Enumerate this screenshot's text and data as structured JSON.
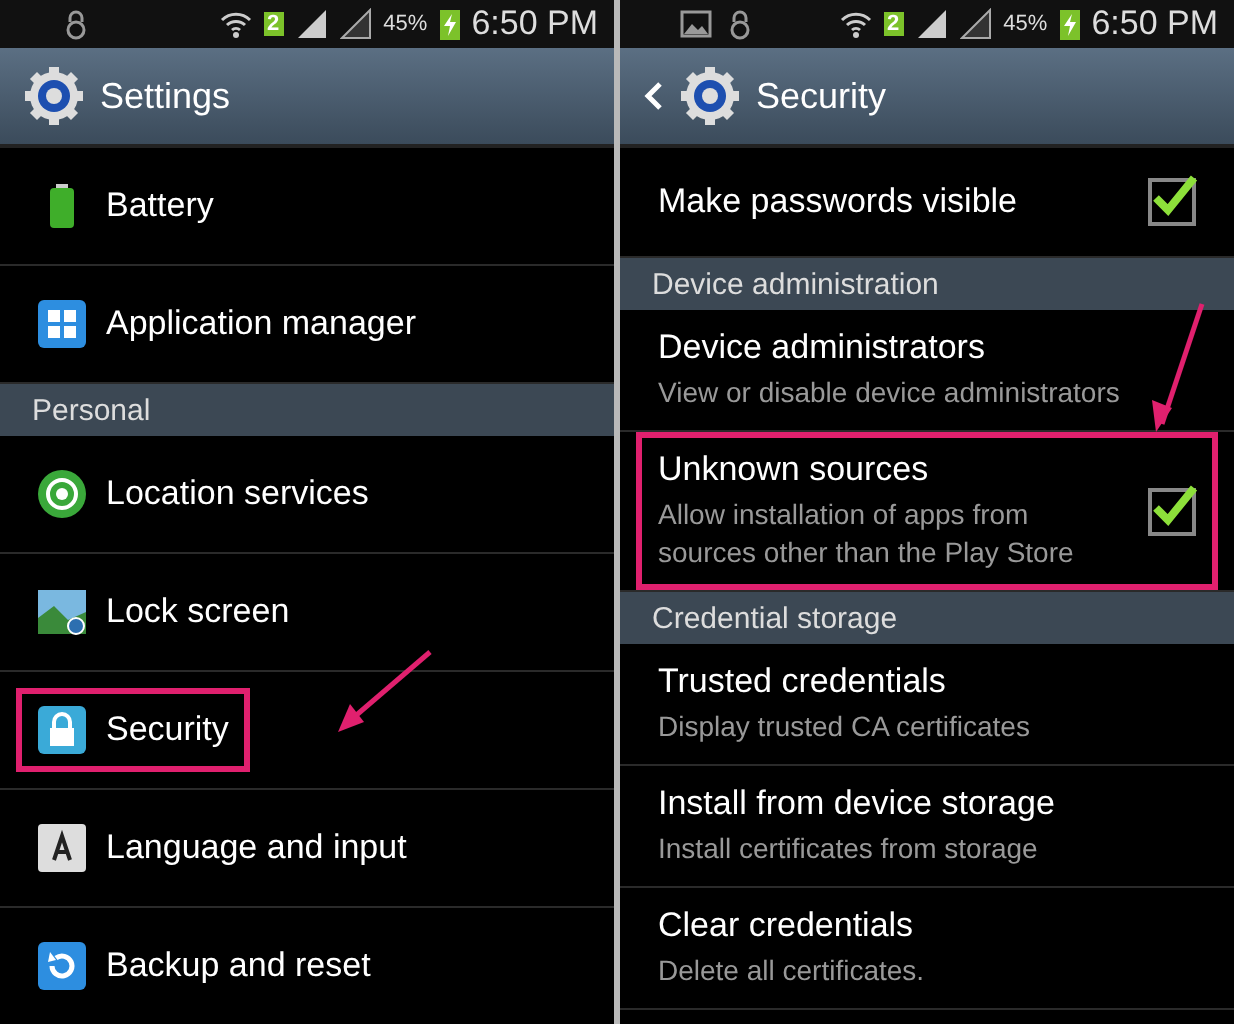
{
  "screens": [
    {
      "status_bar": {
        "sim": "2",
        "battery": "45%",
        "time": "6:50 PM"
      },
      "action_bar": {
        "title": "Settings",
        "back": false
      },
      "items": [
        {
          "kind": "app",
          "label": "Battery",
          "highlighted": false
        },
        {
          "kind": "app",
          "label": "Application manager",
          "highlighted": false
        },
        {
          "kind": "header",
          "label": "Personal"
        },
        {
          "kind": "app",
          "label": "Location services",
          "highlighted": false
        },
        {
          "kind": "app",
          "label": "Lock screen",
          "highlighted": false
        },
        {
          "kind": "app",
          "label": "Security",
          "highlighted": true
        },
        {
          "kind": "app",
          "label": "Language and input",
          "highlighted": false
        },
        {
          "kind": "app",
          "label": "Backup and reset",
          "highlighted": false
        }
      ]
    },
    {
      "status_bar": {
        "sim": "2",
        "battery": "45%",
        "time": "6:50 PM"
      },
      "action_bar": {
        "title": "Security",
        "back": true
      },
      "items": [
        {
          "kind": "check",
          "label": "Make passwords visible",
          "checked": true,
          "highlighted": false
        },
        {
          "kind": "header",
          "label": "Device administration"
        },
        {
          "kind": "text",
          "label": "Device administrators",
          "summary": "View or disable device administrators",
          "highlighted": false
        },
        {
          "kind": "check",
          "label": "Unknown sources",
          "summary": "Allow installation of apps from sources other than the Play Store",
          "checked": true,
          "highlighted": true
        },
        {
          "kind": "header",
          "label": "Credential storage"
        },
        {
          "kind": "text",
          "label": "Trusted credentials",
          "summary": "Display trusted CA certificates",
          "highlighted": false
        },
        {
          "kind": "text",
          "label": "Install from device storage",
          "summary": "Install certificates from storage",
          "highlighted": false
        },
        {
          "kind": "text",
          "label": "Clear credentials",
          "summary": "Delete all certificates.",
          "highlighted": false
        }
      ]
    }
  ]
}
